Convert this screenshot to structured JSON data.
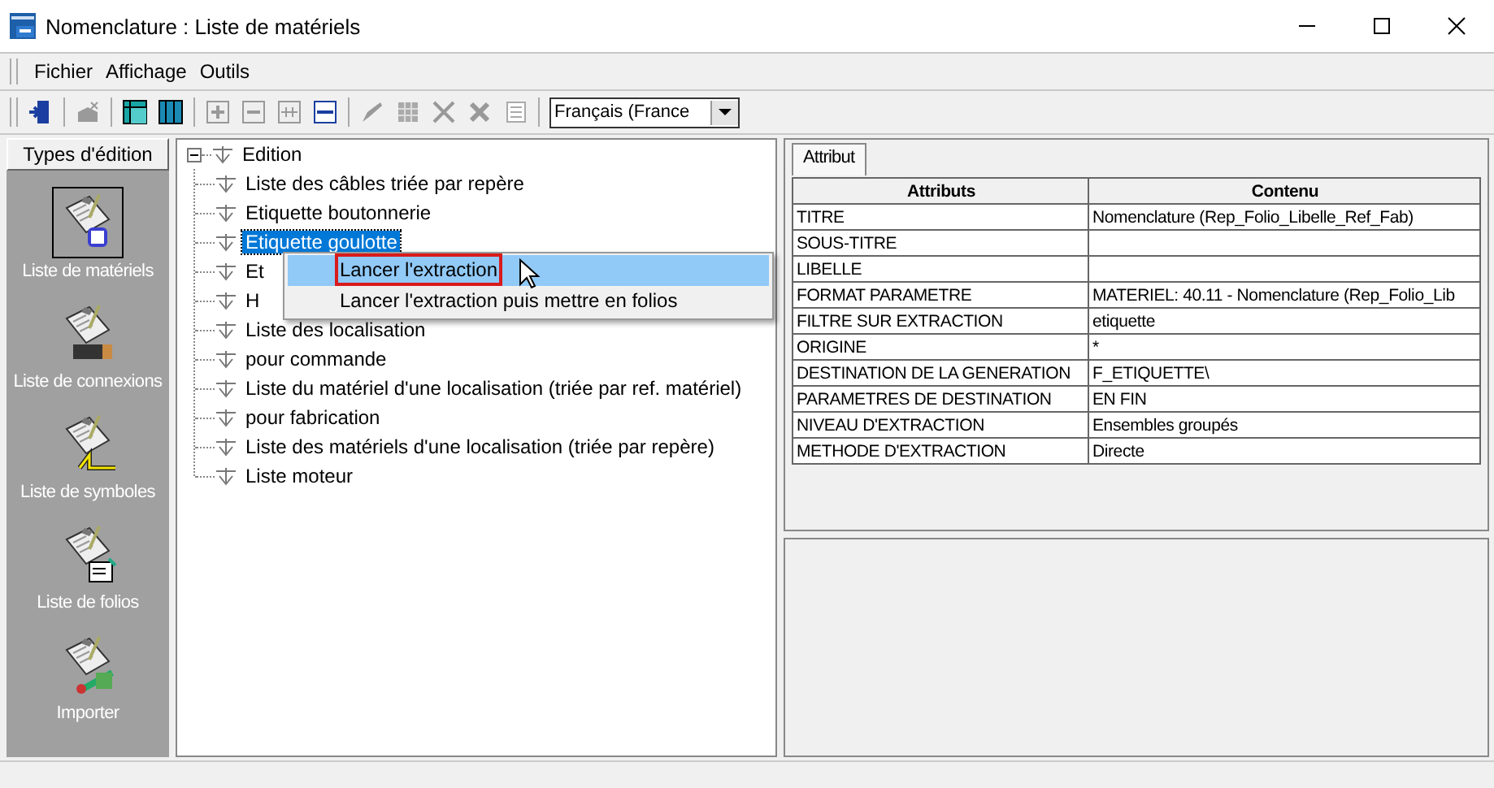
{
  "window": {
    "title": "Nomenclature : Liste de matériels"
  },
  "menu_bar": [
    "Fichier",
    "Affichage",
    "Outils"
  ],
  "toolbar": {
    "language": "Français (France"
  },
  "sidebar": {
    "title": "Types d'édition",
    "items": [
      {
        "label": "Liste de matériels",
        "kind": "materials",
        "selected": true
      },
      {
        "label": "Liste de connexions",
        "kind": "connections",
        "selected": false
      },
      {
        "label": "Liste de symboles",
        "kind": "symbols",
        "selected": false
      },
      {
        "label": "Liste de folios",
        "kind": "folios",
        "selected": false
      },
      {
        "label": "Importer",
        "kind": "import",
        "selected": false
      }
    ]
  },
  "tree": {
    "label": "Edition",
    "expanded": true,
    "children": [
      {
        "label": "Liste des câbles triée par repère",
        "selected": false
      },
      {
        "label": "Etiquette boutonnerie",
        "selected": false
      },
      {
        "label": "Etiquette goulotte",
        "selected": true
      },
      {
        "label": "Et",
        "selected": false
      },
      {
        "label": "H",
        "selected": false
      },
      {
        "label": "Liste des localisation",
        "selected": false
      },
      {
        "label": "pour commande",
        "selected": false
      },
      {
        "label": "Liste du matériel d'une localisation (triée par ref. matériel)",
        "selected": false
      },
      {
        "label": "pour fabrication",
        "selected": false
      },
      {
        "label": "Liste des matériels d'une localisation (triée par repère)",
        "selected": false
      },
      {
        "label": "Liste moteur",
        "selected": false
      }
    ]
  },
  "context_menu": [
    {
      "label": "Lancer l'extraction",
      "selected": true
    },
    {
      "label": "Lancer l'extraction puis mettre en folios",
      "selected": false
    }
  ],
  "tabs": [
    {
      "label": "Attribut",
      "selected": true
    }
  ],
  "table": {
    "columns": [
      "Attributs",
      "Contenu"
    ],
    "rows": [
      [
        "TITRE",
        "Nomenclature (Rep_Folio_Libelle_Ref_Fab)"
      ],
      [
        "SOUS-TITRE",
        ""
      ],
      [
        "LIBELLE",
        ""
      ],
      [
        "FORMAT PARAMETRE",
        "MATERIEL: 40.11 - Nomenclature (Rep_Folio_Lib"
      ],
      [
        "FILTRE SUR EXTRACTION",
        "etiquette"
      ],
      [
        "ORIGINE",
        "*"
      ],
      [
        "DESTINATION DE LA GENERATION",
        "F_ETIQUETTE\\"
      ],
      [
        "PARAMETRES DE DESTINATION",
        "EN FIN"
      ],
      [
        "NIVEAU D'EXTRACTION",
        "Ensembles groupés"
      ],
      [
        "METHODE D'EXTRACTION",
        "Directe"
      ]
    ]
  }
}
